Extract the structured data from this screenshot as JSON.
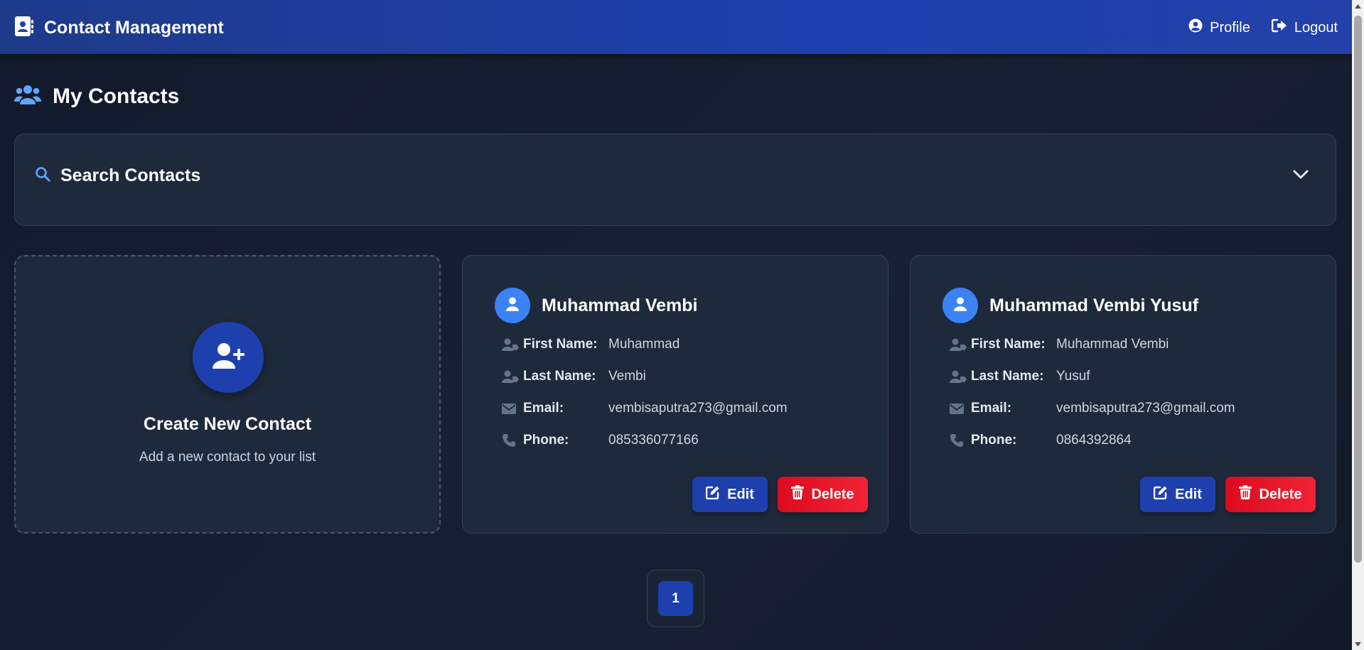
{
  "app": {
    "title": "Contact Management"
  },
  "nav": {
    "profile_label": "Profile",
    "logout_label": "Logout"
  },
  "page": {
    "title": "My Contacts"
  },
  "search": {
    "title": "Search Contacts"
  },
  "create_card": {
    "title": "Create New Contact",
    "subtitle": "Add a new contact to your list"
  },
  "field_labels": {
    "first_name": "First Name:",
    "last_name": "Last Name:",
    "email": "Email:",
    "phone": "Phone:"
  },
  "contacts": [
    {
      "full_name": "Muhammad Vembi",
      "first_name": "Muhammad",
      "last_name": "Vembi",
      "email": "vembisaputra273@gmail.com",
      "phone": "085336077166",
      "edit_label": "Edit",
      "delete_label": "Delete"
    },
    {
      "full_name": "Muhammad Vembi Yusuf",
      "first_name": "Muhammad Vembi",
      "last_name": "Yusuf",
      "email": "vembisaputra273@gmail.com",
      "phone": "0864392864",
      "edit_label": "Edit",
      "delete_label": "Delete"
    }
  ],
  "pagination": {
    "current_page": "1"
  },
  "colors": {
    "navbar": "#1e40af",
    "accent": "#3b82f6",
    "background": "#111827",
    "card": "#1e293b",
    "danger": "#dc0a1e"
  },
  "icons": {
    "brand": "address-book-icon",
    "profile": "user-circle-icon",
    "logout": "sign-out-icon",
    "heading": "users-icon",
    "search": "search-icon",
    "expand": "chevron-down-icon",
    "create": "user-plus-icon",
    "avatar": "user-icon",
    "name_field": "user-tag-icon",
    "email_field": "envelope-icon",
    "phone_field": "phone-icon",
    "edit": "edit-icon",
    "delete": "trash-icon"
  }
}
